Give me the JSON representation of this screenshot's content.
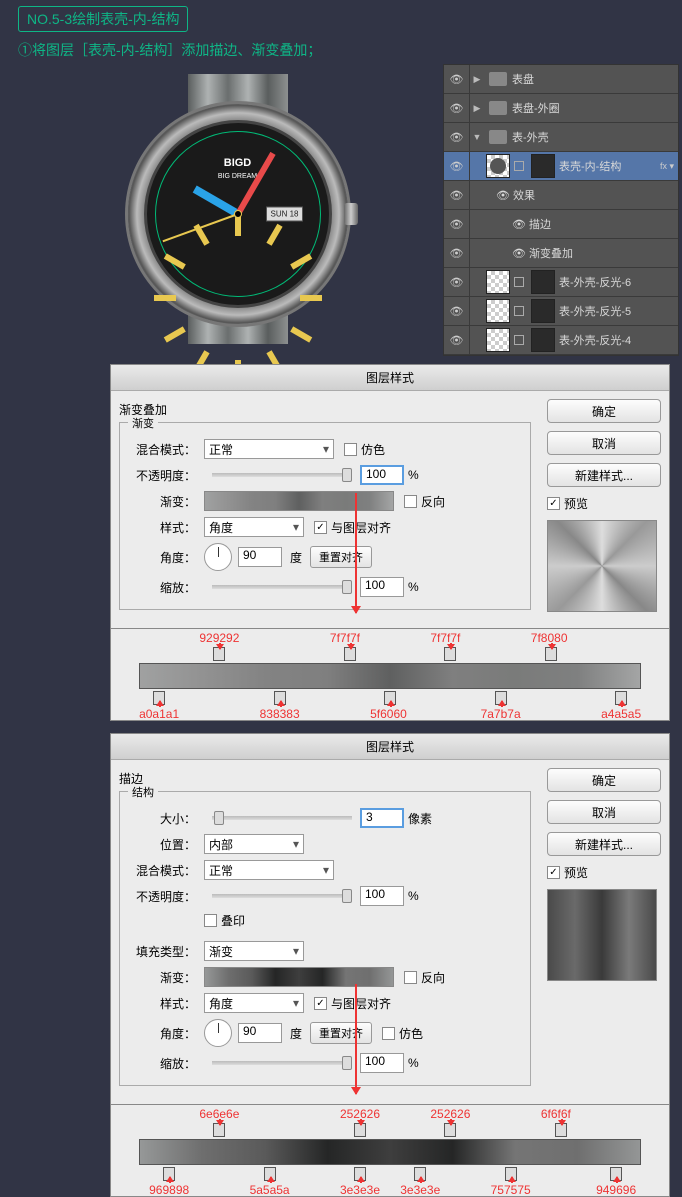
{
  "title": "NO.5-3绘制表壳-内-结构",
  "instruction": "①将图层［表壳-内-结构］添加描边、渐变叠加；",
  "watch": {
    "brand": "BIGD",
    "brand_sub": "BIG DREAM",
    "date": "SUN 18"
  },
  "layers": {
    "items": [
      {
        "label": "表盘",
        "type": "folder",
        "expand": "▶"
      },
      {
        "label": "表盘-外圈",
        "type": "folder",
        "expand": "▶"
      },
      {
        "label": "表-外壳",
        "type": "folder",
        "expand": "▼"
      },
      {
        "label": "表壳-内-结构",
        "type": "layer",
        "selected": true,
        "fx": true
      },
      {
        "label": "效果",
        "type": "fx-head"
      },
      {
        "label": "描边",
        "type": "fx-item"
      },
      {
        "label": "渐变叠加",
        "type": "fx-item"
      },
      {
        "label": "表-外壳-反光-6",
        "type": "layer"
      },
      {
        "label": "表-外壳-反光-5",
        "type": "layer"
      },
      {
        "label": "表-外壳-反光-4",
        "type": "layer"
      }
    ]
  },
  "dialog1": {
    "title": "图层样式",
    "section": "渐变叠加",
    "subsection": "渐变",
    "blend_label": "混合模式：",
    "blend_value": "正常",
    "dither_label": "仿色",
    "opacity_label": "不透明度：",
    "opacity_value": "100",
    "pct": "%",
    "grad_label": "渐变：",
    "reverse_label": "反向",
    "style_label": "样式：",
    "style_value": "角度",
    "align_label": "与图层对齐",
    "angle_label": "角度：",
    "angle_value": "90",
    "angle_unit": "度",
    "reset_btn": "重置对齐",
    "scale_label": "缩放：",
    "scale_value": "100",
    "ok": "确定",
    "cancel": "取消",
    "newstyle": "新建样式...",
    "preview": "预览"
  },
  "grad1": {
    "tops": [
      {
        "pos": 16,
        "hex": "929292"
      },
      {
        "pos": 42,
        "hex": "7f7f7f"
      },
      {
        "pos": 62,
        "hex": "7f7f7f"
      },
      {
        "pos": 82,
        "hex": "7f8080"
      }
    ],
    "bots": [
      {
        "pos": 4,
        "hex": "a0a1a1"
      },
      {
        "pos": 28,
        "hex": "838383"
      },
      {
        "pos": 50,
        "hex": "5f6060"
      },
      {
        "pos": 72,
        "hex": "7a7b7a"
      },
      {
        "pos": 96,
        "hex": "a4a5a5"
      }
    ]
  },
  "dialog2": {
    "title": "图层样式",
    "section": "描边",
    "subsection": "结构",
    "size_label": "大小：",
    "size_value": "3",
    "px": "像素",
    "pos_label": "位置：",
    "pos_value": "内部",
    "blend_label": "混合模式：",
    "blend_value": "正常",
    "opacity_label": "不透明度：",
    "opacity_value": "100",
    "pct": "%",
    "overprint_label": "叠印",
    "fill_label": "填充类型：",
    "fill_value": "渐变",
    "grad_label": "渐变：",
    "reverse_label": "反向",
    "style_label": "样式：",
    "style_value": "角度",
    "align_label": "与图层对齐",
    "angle_label": "角度：",
    "angle_value": "90",
    "angle_unit": "度",
    "reset_btn": "重置对齐",
    "dither_label": "仿色",
    "scale_label": "缩放：",
    "scale_value": "100",
    "ok": "确定",
    "cancel": "取消",
    "newstyle": "新建样式...",
    "preview": "预览"
  },
  "grad2": {
    "tops": [
      {
        "pos": 16,
        "hex": "6e6e6e"
      },
      {
        "pos": 44,
        "hex": "252626"
      },
      {
        "pos": 62,
        "hex": "252626"
      },
      {
        "pos": 84,
        "hex": "6f6f6f"
      }
    ],
    "bots": [
      {
        "pos": 6,
        "hex": "969898"
      },
      {
        "pos": 26,
        "hex": "5a5a5a"
      },
      {
        "pos": 44,
        "hex": "3e3e3e"
      },
      {
        "pos": 56,
        "hex": "3e3e3e"
      },
      {
        "pos": 74,
        "hex": "757575"
      },
      {
        "pos": 95,
        "hex": "949696"
      }
    ]
  },
  "chart_data": [
    {
      "type": "table",
      "title": "Gradient Overlay stops (Dialog 1)",
      "top_stops": [
        {
          "position_pct": 16,
          "hex": "929292"
        },
        {
          "position_pct": 42,
          "hex": "7f7f7f"
        },
        {
          "position_pct": 62,
          "hex": "7f7f7f"
        },
        {
          "position_pct": 82,
          "hex": "7f8080"
        }
      ],
      "bottom_stops": [
        {
          "position_pct": 4,
          "hex": "a0a1a1"
        },
        {
          "position_pct": 28,
          "hex": "838383"
        },
        {
          "position_pct": 50,
          "hex": "5f6060"
        },
        {
          "position_pct": 72,
          "hex": "7a7b7a"
        },
        {
          "position_pct": 96,
          "hex": "a4a5a5"
        }
      ]
    },
    {
      "type": "table",
      "title": "Stroke gradient stops (Dialog 2)",
      "top_stops": [
        {
          "position_pct": 16,
          "hex": "6e6e6e"
        },
        {
          "position_pct": 44,
          "hex": "252626"
        },
        {
          "position_pct": 62,
          "hex": "252626"
        },
        {
          "position_pct": 84,
          "hex": "6f6f6f"
        }
      ],
      "bottom_stops": [
        {
          "position_pct": 6,
          "hex": "969898"
        },
        {
          "position_pct": 26,
          "hex": "5a5a5a"
        },
        {
          "position_pct": 44,
          "hex": "3e3e3e"
        },
        {
          "position_pct": 56,
          "hex": "3e3e3e"
        },
        {
          "position_pct": 74,
          "hex": "757575"
        },
        {
          "position_pct": 95,
          "hex": "949696"
        }
      ]
    }
  ]
}
